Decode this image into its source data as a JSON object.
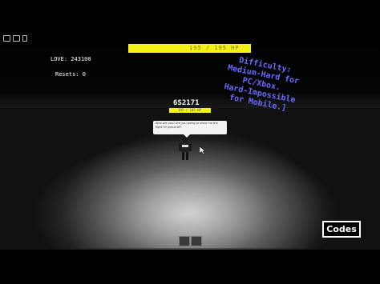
{
  "hud": {
    "love_label": "LOVE:",
    "love_value": "243100",
    "resets_label": "Resets:",
    "resets_value": "0",
    "hp_text": "195 / 195 HP"
  },
  "difficulty_lines": [
    "Difficulty:",
    "Medium-Hard for",
    "PC/Xbox.",
    "Hard-Impossible",
    "for Mobile.]"
  ],
  "player": {
    "name": "6S2171",
    "hp_text": "195 / 195 HP",
    "chat": "Who are you? Are you going to show me the fight I'm proud of?"
  },
  "codes_button": "Codes",
  "colors": {
    "hp_yellow": "#f4f214",
    "difficulty_blue": "#6a6aff"
  }
}
